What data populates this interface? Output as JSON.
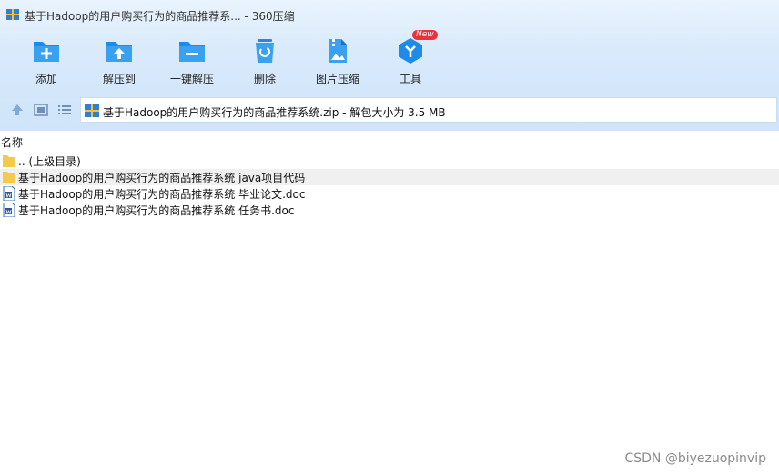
{
  "window": {
    "title": "基于Hadoop的用户购买行为的商品推荐系... - 360压缩"
  },
  "toolbar": {
    "items": [
      {
        "label": "添加",
        "icon": "add-icon"
      },
      {
        "label": "解压到",
        "icon": "extract-to-icon"
      },
      {
        "label": "一键解压",
        "icon": "one-click-extract-icon"
      },
      {
        "label": "删除",
        "icon": "delete-icon"
      },
      {
        "label": "图片压缩",
        "icon": "image-compress-icon"
      },
      {
        "label": "工具",
        "icon": "tools-icon",
        "badge": "New"
      }
    ]
  },
  "navigation": {
    "path": "基于Hadoop的用户购买行为的商品推荐系统.zip - 解包大小为 3.5 MB"
  },
  "list": {
    "column_name": "名称",
    "rows": [
      {
        "name": ".. (上级目录)",
        "type": "folder"
      },
      {
        "name": "基于Hadoop的用户购买行为的商品推荐系统  java项目代码",
        "type": "folder",
        "selected": true
      },
      {
        "name": "基于Hadoop的用户购买行为的商品推荐系统 毕业论文.doc",
        "type": "doc"
      },
      {
        "name": "基于Hadoop的用户购买行为的商品推荐系统 任务书.doc",
        "type": "doc"
      }
    ]
  },
  "watermark": "CSDN @biyezuopinvip",
  "colors": {
    "accent": "#1e8be8",
    "folder": "#f5c94a",
    "badge": "#e8333b"
  }
}
